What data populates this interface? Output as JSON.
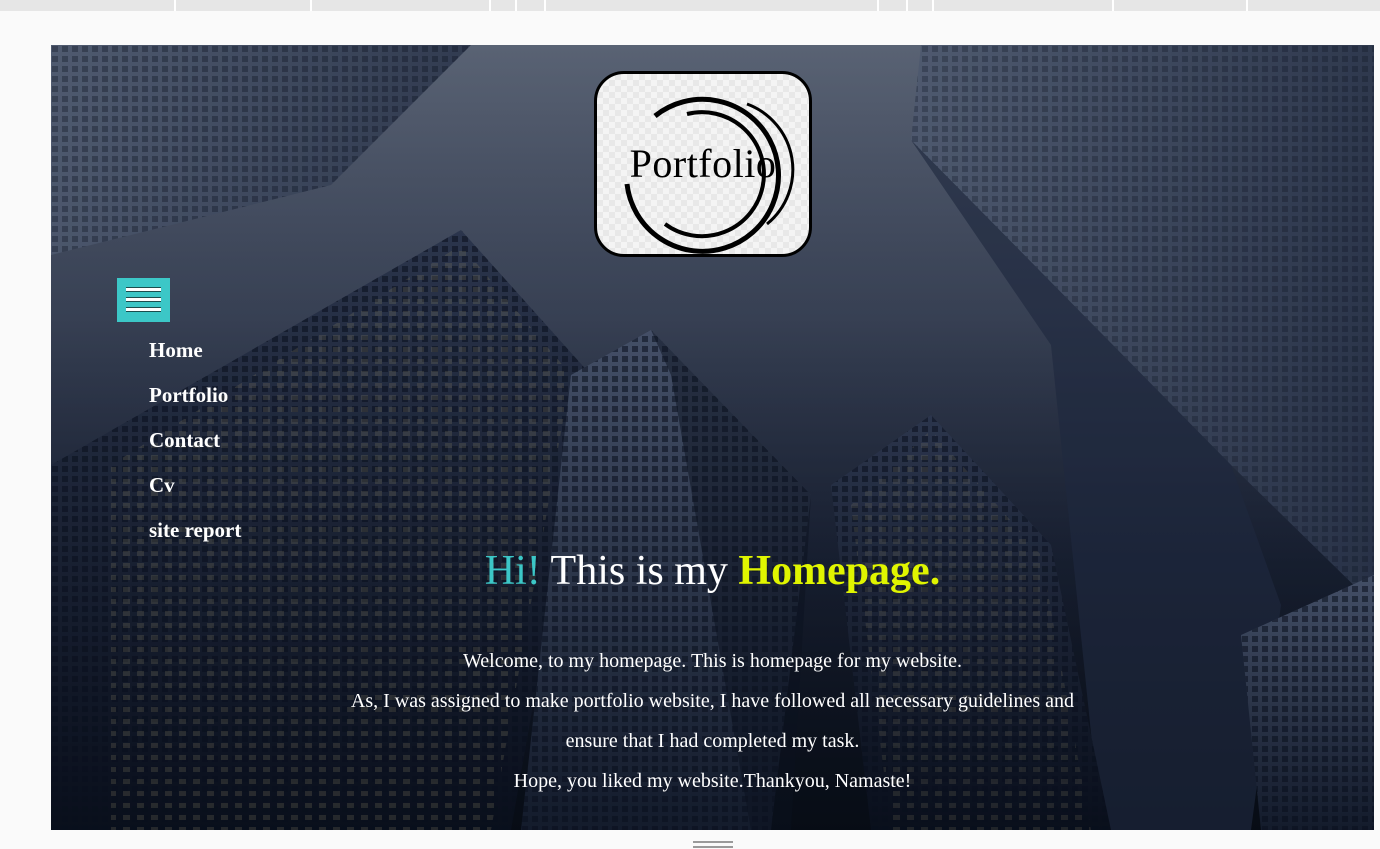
{
  "logo": {
    "text": "Portfolio"
  },
  "menu": {
    "toggle_icon": "hamburger-icon",
    "accent_color": "#3cc7c7"
  },
  "nav": {
    "items": [
      {
        "label": "Home"
      },
      {
        "label": "Portfolio"
      },
      {
        "label": "Contact"
      },
      {
        "label": "Cv"
      },
      {
        "label": "site report"
      }
    ]
  },
  "hero": {
    "greeting": "Hi!",
    "title_middle": "This is my",
    "title_highlight": "Homepage.",
    "greeting_color": "#3cc7c7",
    "highlight_color": "#e0f500",
    "paragraphs": [
      "Welcome, to my homepage. This is homepage for my website.",
      "As, I was assigned to make portfolio website, I have followed all necessary guidelines and",
      "ensure that I had completed my task.",
      "Hope, you liked my website.Thankyou, Namaste!"
    ]
  }
}
